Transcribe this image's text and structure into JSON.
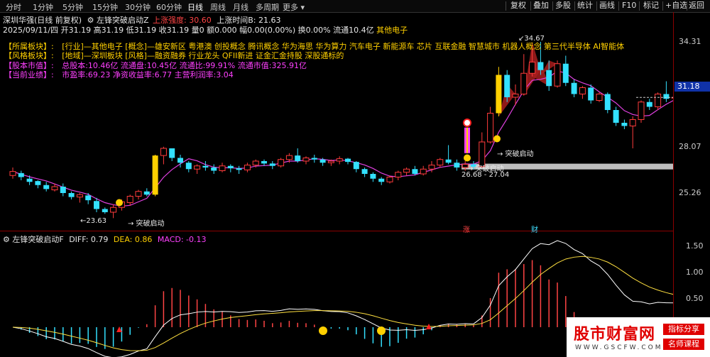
{
  "toolbar": {
    "periods": [
      "分时",
      "1分钟",
      "5分钟",
      "15分钟",
      "30分钟",
      "60分钟",
      "日线",
      "周线",
      "月线",
      "多周期",
      "更多"
    ],
    "active_period": "日线",
    "right_buttons": [
      "复权",
      "叠加",
      "多股",
      "统计",
      "画线",
      "F10",
      "标记",
      "+自选",
      "返回"
    ]
  },
  "header": {
    "title": "深圳华强(日线 前复权)",
    "indicator_name": "左锋突破启动Z",
    "strength_label": "上涨强度: 30.60",
    "time_label": "上涨时间B: 21.63"
  },
  "quote": {
    "date": "2025/09/11/四",
    "open": "开31.19",
    "high": "高31.19",
    "low": "低31.19",
    "close": "收31.19",
    "volume": "量0",
    "amount": "额0.000",
    "amp": "幅0.00(0.00%)",
    "turnover": "换0.00%",
    "float": "流通10.4亿",
    "sector": "其他电子"
  },
  "info": {
    "sector_label": "【所属板块】:",
    "sector_value": "[行业]—其他电子 [概念]—雄安新区 粤港澳 创投概念 腾讯概念 华为海思 华为算力 汽车电子 新能源车 芯片 互联金融 智慧城市 机器人概念 第三代半导体 AI智能体",
    "style_label": "【风格板块】:",
    "style_value": "[地域]—深圳板块 [风格]—融资融券 行业龙头 QFII新进 证金汇金持股 深股通标的",
    "capital_label": "【股本市值】:",
    "capital_value": "总股本:10.46亿 流通盘:10.45亿 流通比:99.91% 流通市值:325.91亿",
    "perf_label": "【当前业绩】:",
    "perf_value": "市盈率:69.23 净资收益率:6.77 主营利润率:3.04"
  },
  "price_axis": [
    "34.31",
    "31.18",
    "28.07",
    "25.26"
  ],
  "current_price": "31.18",
  "annotations": {
    "high": "34.67",
    "low": "23.63",
    "breakout1": "→ 突破启动",
    "breakout2": "→ 突破启动",
    "breakout3": "→ 突破启动",
    "range": "26.68 - 27.04",
    "zhang": "涨",
    "cai": "财"
  },
  "macd": {
    "title": "左锋突破启动F",
    "diff": "DIFF: 0.79",
    "dea": "DEA: 0.86",
    "macd": "MACD: -0.13",
    "axis": [
      "1.50",
      "1.00",
      "0.50"
    ]
  },
  "watermark": {
    "title": "股市财富网",
    "url": "WWW.GSCFW.COM",
    "tag1": "指标分享",
    "tag2": "名师课程"
  },
  "candles": [
    {
      "o": 26.3,
      "c": 26.55,
      "h": 26.8,
      "l": 26.1
    },
    {
      "o": 26.45,
      "c": 26.2,
      "h": 26.6,
      "l": 26.0
    },
    {
      "o": 26.1,
      "c": 25.9,
      "h": 26.3,
      "l": 25.7
    },
    {
      "o": 25.95,
      "c": 25.7,
      "h": 26.0,
      "l": 25.5
    },
    {
      "o": 25.7,
      "c": 25.45,
      "h": 25.9,
      "l": 25.3
    },
    {
      "o": 25.4,
      "c": 25.6,
      "h": 25.8,
      "l": 25.3
    },
    {
      "o": 25.6,
      "c": 25.2,
      "h": 25.8,
      "l": 25.0
    },
    {
      "o": 25.2,
      "c": 24.95,
      "h": 25.3,
      "l": 24.8
    },
    {
      "o": 24.95,
      "c": 25.1,
      "h": 25.2,
      "l": 24.6
    },
    {
      "o": 25.05,
      "c": 24.75,
      "h": 25.2,
      "l": 24.5
    },
    {
      "o": 24.7,
      "c": 24.2,
      "h": 24.9,
      "l": 24.0
    },
    {
      "o": 24.2,
      "c": 24.0,
      "h": 24.3,
      "l": 23.9
    },
    {
      "o": 24.0,
      "c": 24.3,
      "h": 24.5,
      "l": 23.63
    },
    {
      "o": 24.3,
      "c": 24.65,
      "h": 24.8,
      "l": 24.1
    },
    {
      "o": 24.6,
      "c": 25.0,
      "h": 25.1,
      "l": 24.4
    },
    {
      "o": 25.0,
      "c": 25.3,
      "h": 25.4,
      "l": 24.8
    },
    {
      "o": 25.3,
      "c": 25.1,
      "h": 25.5,
      "l": 25.0
    },
    {
      "o": 25.1,
      "c": 27.55,
      "h": 27.6,
      "l": 25.0
    },
    {
      "o": 27.55,
      "c": 28.0,
      "h": 28.1,
      "l": 27.0
    },
    {
      "o": 28.0,
      "c": 27.4,
      "h": 28.0,
      "l": 27.2
    },
    {
      "o": 27.4,
      "c": 27.1,
      "h": 27.6,
      "l": 26.8
    },
    {
      "o": 27.1,
      "c": 26.7,
      "h": 27.2,
      "l": 26.5
    },
    {
      "o": 26.7,
      "c": 26.9,
      "h": 27.0,
      "l": 26.4
    },
    {
      "o": 26.9,
      "c": 26.8,
      "h": 27.2,
      "l": 26.6
    },
    {
      "o": 26.8,
      "c": 26.6,
      "h": 27.0,
      "l": 26.4
    },
    {
      "o": 26.6,
      "c": 26.9,
      "h": 27.1,
      "l": 26.5
    },
    {
      "o": 26.9,
      "c": 26.75,
      "h": 27.0,
      "l": 26.5
    },
    {
      "o": 26.75,
      "c": 26.65,
      "h": 26.9,
      "l": 26.4
    },
    {
      "o": 26.65,
      "c": 26.95,
      "h": 27.1,
      "l": 26.5
    },
    {
      "o": 26.95,
      "c": 27.2,
      "h": 27.3,
      "l": 26.8
    },
    {
      "o": 27.2,
      "c": 27.05,
      "h": 27.3,
      "l": 26.9
    },
    {
      "o": 27.05,
      "c": 26.9,
      "h": 27.2,
      "l": 26.7
    },
    {
      "o": 26.9,
      "c": 27.3,
      "h": 27.4,
      "l": 26.8
    },
    {
      "o": 27.3,
      "c": 27.55,
      "h": 27.7,
      "l": 27.1
    },
    {
      "o": 27.55,
      "c": 27.2,
      "h": 28.0,
      "l": 27.1
    },
    {
      "o": 27.2,
      "c": 27.4,
      "h": 27.5,
      "l": 27.0
    },
    {
      "o": 27.4,
      "c": 27.3,
      "h": 27.6,
      "l": 27.1
    },
    {
      "o": 27.3,
      "c": 27.1,
      "h": 27.4,
      "l": 26.9
    },
    {
      "o": 27.1,
      "c": 27.2,
      "h": 27.3,
      "l": 26.9
    },
    {
      "o": 27.2,
      "c": 27.35,
      "h": 27.5,
      "l": 27.0
    },
    {
      "o": 27.35,
      "c": 27.15,
      "h": 27.4,
      "l": 27.0
    },
    {
      "o": 27.15,
      "c": 26.7,
      "h": 27.2,
      "l": 26.5
    },
    {
      "o": 26.7,
      "c": 26.4,
      "h": 26.8,
      "l": 26.2
    },
    {
      "o": 26.4,
      "c": 26.1,
      "h": 26.5,
      "l": 25.9
    },
    {
      "o": 26.1,
      "c": 25.9,
      "h": 26.2,
      "l": 25.7
    },
    {
      "o": 25.9,
      "c": 26.2,
      "h": 26.3,
      "l": 25.8
    },
    {
      "o": 26.2,
      "c": 26.5,
      "h": 26.6,
      "l": 26.0
    },
    {
      "o": 26.5,
      "c": 26.7,
      "h": 26.8,
      "l": 26.3
    },
    {
      "o": 26.7,
      "c": 26.4,
      "h": 26.9,
      "l": 26.3
    },
    {
      "o": 26.4,
      "c": 26.7,
      "h": 26.9,
      "l": 26.3
    },
    {
      "o": 26.7,
      "c": 26.95,
      "h": 27.2,
      "l": 26.5
    },
    {
      "o": 26.95,
      "c": 27.3,
      "h": 27.4,
      "l": 26.8
    },
    {
      "o": 27.3,
      "c": 27.1,
      "h": 28.2,
      "l": 27.0
    },
    {
      "o": 27.1,
      "c": 26.8,
      "h": 27.3,
      "l": 26.6
    },
    {
      "o": 26.8,
      "c": 27.0,
      "h": 27.2,
      "l": 26.6
    },
    {
      "o": 27.0,
      "c": 26.85,
      "h": 27.2,
      "l": 26.68
    },
    {
      "o": 26.85,
      "c": 28.4,
      "h": 29.0,
      "l": 26.8
    },
    {
      "o": 28.4,
      "c": 30.2,
      "h": 30.6,
      "l": 28.3
    },
    {
      "o": 30.2,
      "c": 32.6,
      "h": 33.1,
      "l": 30.0
    },
    {
      "o": 32.6,
      "c": 31.2,
      "h": 32.9,
      "l": 30.9
    },
    {
      "o": 31.2,
      "c": 31.4,
      "h": 32.0,
      "l": 30.7
    },
    {
      "o": 31.4,
      "c": 32.7,
      "h": 33.9,
      "l": 31.3
    },
    {
      "o": 32.7,
      "c": 33.4,
      "h": 34.2,
      "l": 32.5
    },
    {
      "o": 33.4,
      "c": 32.9,
      "h": 34.67,
      "l": 32.6
    },
    {
      "o": 32.9,
      "c": 31.9,
      "h": 33.5,
      "l": 31.6
    },
    {
      "o": 31.9,
      "c": 33.3,
      "h": 33.5,
      "l": 31.8
    },
    {
      "o": 33.3,
      "c": 32.1,
      "h": 33.8,
      "l": 31.9
    },
    {
      "o": 32.1,
      "c": 31.4,
      "h": 32.3,
      "l": 31.2
    },
    {
      "o": 31.4,
      "c": 31.8,
      "h": 31.9,
      "l": 31.1
    },
    {
      "o": 31.8,
      "c": 31.0,
      "h": 32.0,
      "l": 30.8
    },
    {
      "o": 31.0,
      "c": 31.4,
      "h": 31.5,
      "l": 30.9
    },
    {
      "o": 31.4,
      "c": 30.4,
      "h": 31.5,
      "l": 30.2
    },
    {
      "o": 30.4,
      "c": 29.6,
      "h": 30.6,
      "l": 29.4
    },
    {
      "o": 29.6,
      "c": 29.4,
      "h": 29.8,
      "l": 29.2
    },
    {
      "o": 29.4,
      "c": 29.8,
      "h": 30.0,
      "l": 28.0
    },
    {
      "o": 29.8,
      "c": 30.9,
      "h": 31.0,
      "l": 29.6
    },
    {
      "o": 30.9,
      "c": 30.6,
      "h": 31.1,
      "l": 30.4
    },
    {
      "o": 30.6,
      "c": 31.4,
      "h": 31.5,
      "l": 30.4
    },
    {
      "o": 31.4,
      "c": 31.1,
      "h": 32.2,
      "l": 30.9
    },
    {
      "o": 31.19,
      "c": 31.19,
      "h": 31.19,
      "l": 31.19
    }
  ]
}
